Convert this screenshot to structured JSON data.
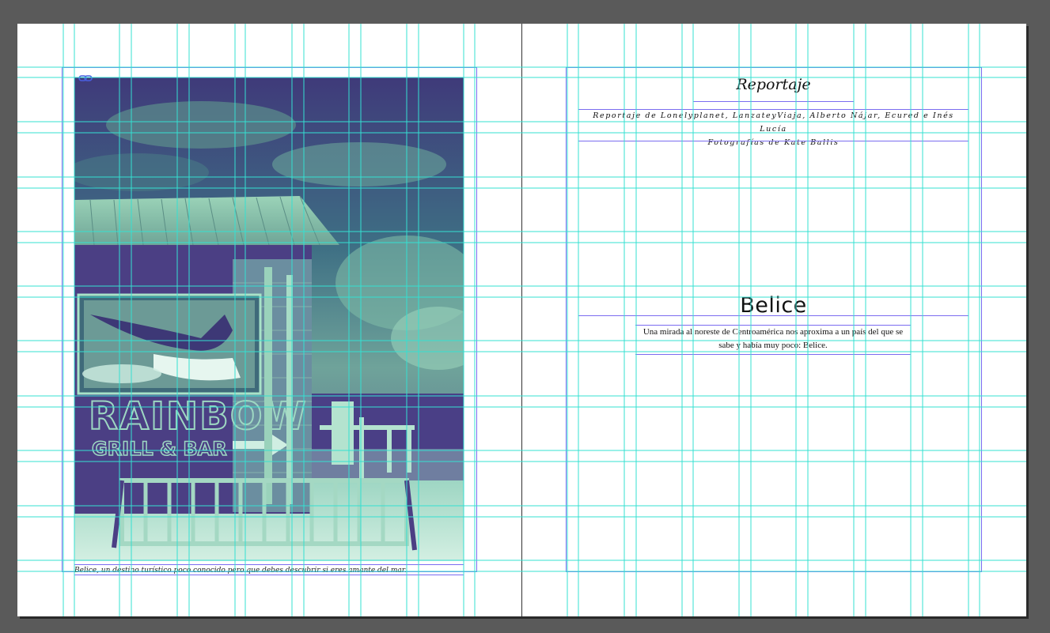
{
  "colors": {
    "pasteboard": "#5a5a5a",
    "page": "#ffffff",
    "guide": "#34e0d2",
    "margin": "#7b6cf0",
    "frame_edge": "#7b6cf0",
    "photo_duotone_dark": "#4e3f86",
    "photo_duotone_light": "#a8e3c8"
  },
  "left_page": {
    "photo": {
      "sign_line_1": "RAINBOW",
      "sign_line_2": "GRILL & BAR",
      "link_icon": "link-icon"
    },
    "caption": "Belice, un destino turístico poco conocido pero que debes descubrir si eres amante del mar."
  },
  "right_page": {
    "section_title": "Reportaje",
    "credits_line_1": "Reportaje de Lonelyplanet, LanzateyViaja, Alberto Nájar, Ecured e Inés Lucía",
    "credits_line_2": "Fotografías de Kate Ballis",
    "headline": "Belice",
    "subhead": "Una mirada al noreste de Centroamérica nos aproxima a un país del que se sabe y había muy poco: Belice."
  }
}
